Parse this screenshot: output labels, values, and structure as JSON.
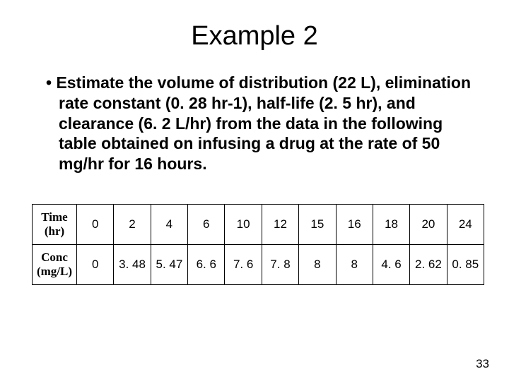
{
  "title": "Example 2",
  "bullet": "Estimate the volume of distribution (22 L), elimination rate constant (0. 28 hr-1), half-life (2. 5 hr), and clearance (6. 2 L/hr) from the data in the following table obtained on infusing a drug at the rate of 50 mg/hr for 16 hours.",
  "chart_data": {
    "type": "table",
    "rows": [
      {
        "label": "Time (hr)",
        "values": [
          "0",
          "2",
          "4",
          "6",
          "10",
          "12",
          "15",
          "16",
          "18",
          "20",
          "24"
        ]
      },
      {
        "label": "Conc (mg/L)",
        "values": [
          "0",
          "3. 48",
          "5. 47",
          "6. 6",
          "7. 6",
          "7. 8",
          "8",
          "8",
          "4. 6",
          "2. 62",
          "0. 85"
        ]
      }
    ]
  },
  "page_number": "33"
}
